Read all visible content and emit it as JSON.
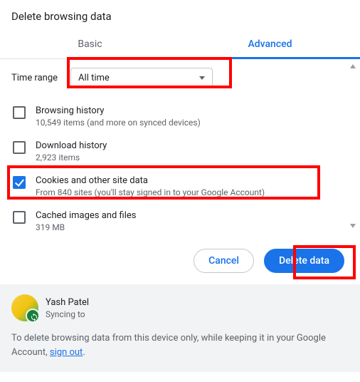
{
  "title": "Delete browsing data",
  "tabs": {
    "basic": "Basic",
    "advanced": "Advanced",
    "active": "advanced"
  },
  "timerange": {
    "label": "Time range",
    "value": "All time"
  },
  "options": [
    {
      "checked": false,
      "primary": "Browsing history",
      "secondary": "10,549 items (and more on synced devices)"
    },
    {
      "checked": false,
      "primary": "Download history",
      "secondary": "2,923 items"
    },
    {
      "checked": true,
      "primary": "Cookies and other site data",
      "secondary": "From 840 sites (you'll stay signed in to your Google Account)"
    },
    {
      "checked": false,
      "primary": "Cached images and files",
      "secondary": "319 MB"
    }
  ],
  "buttons": {
    "cancel": "Cancel",
    "primary": "Delete data"
  },
  "account": {
    "name": "Yash Patel",
    "sync_label": "Syncing to",
    "sync_target": ""
  },
  "footer": {
    "text_pre": "To delete browsing data from this device only, while keeping it in your Google Account, ",
    "link": "sign out",
    "text_post": "."
  },
  "highlights": {
    "timerange": true,
    "cookies": true,
    "delete": true
  }
}
